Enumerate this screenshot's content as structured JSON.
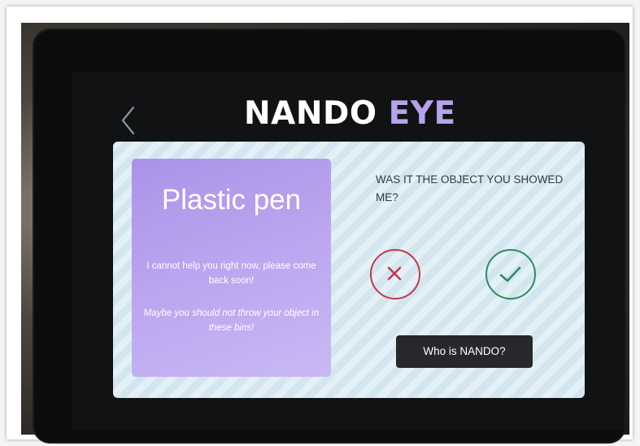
{
  "header": {
    "title_word1": "NANDO",
    "title_word2": "EYE",
    "back_icon": "chevron-left-icon"
  },
  "result_card": {
    "object_name": "Plastic pen",
    "message_1": "I cannot help you right now, please come back soon!",
    "message_2": "Maybe you should not throw your object in these bins!"
  },
  "confirmation": {
    "question": "WAS IT THE OBJECT YOU SHOWED ME?",
    "reject_icon": "x-circle-icon",
    "confirm_icon": "check-circle-icon"
  },
  "who_button": {
    "label": "Who is NANDO?"
  },
  "colors": {
    "title_primary": "#ffffff",
    "title_accent": "#b7a3ec",
    "card": "#b7a3ec",
    "reject": "#c0394a",
    "confirm": "#2f8a5f",
    "button_bg": "#27282b"
  }
}
